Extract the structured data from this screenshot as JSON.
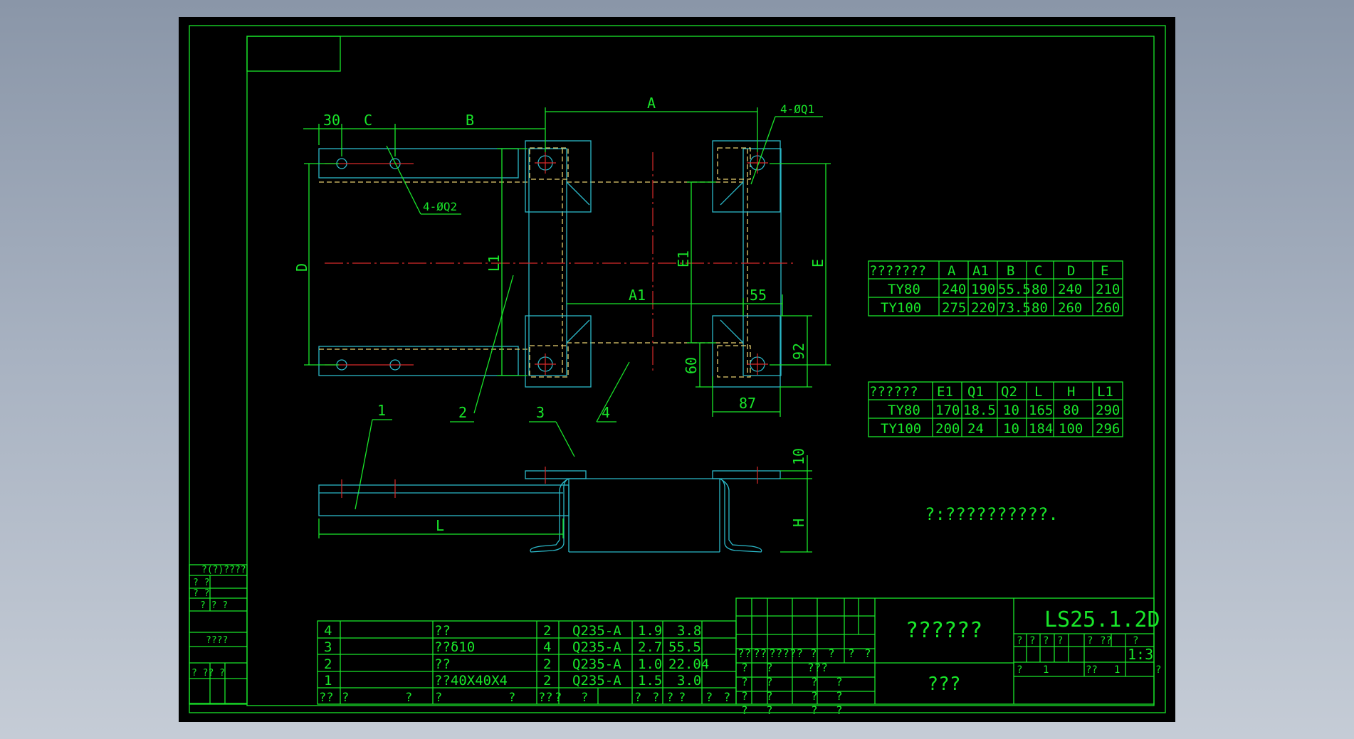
{
  "title_block": {
    "drawing_name": "??????",
    "company": "???",
    "drawing_no": "LS25.1.2D",
    "scale": "1:3",
    "row_a": [
      "?",
      "?",
      "?",
      "?",
      "?",
      "??",
      "?"
    ],
    "row_b": [
      "?",
      "1",
      "??",
      "1",
      "?"
    ]
  },
  "sign_rows": [
    [
      "??",
      "??",
      "?????",
      "?",
      "?",
      "?",
      "?"
    ],
    [
      "?",
      "?",
      "???"
    ],
    [
      "?",
      "?",
      "?",
      "?"
    ],
    [
      "?",
      "?",
      "?",
      "?"
    ],
    [
      "?",
      "?",
      "?",
      "?"
    ]
  ],
  "sidebar": {
    "rows": [
      "?(?)????",
      "? ?",
      "? ?",
      "? ? ?",
      "????",
      "? ?? ?"
    ]
  },
  "bom": {
    "rows": [
      {
        "no": "4",
        "name": "??",
        "qty": "2",
        "material": "Q235-A",
        "unit_w": "1.9",
        "total_w": "3.8"
      },
      {
        "no": "3",
        "name": "??δ10",
        "qty": "4",
        "material": "Q235-A",
        "unit_w": "2.7",
        "total_w": "55.5"
      },
      {
        "no": "2",
        "name": "??",
        "qty": "2",
        "material": "Q235-A",
        "unit_w": "1.0",
        "total_w": "22.04"
      },
      {
        "no": "1",
        "name": "??40X40X4",
        "qty": "2",
        "material": "Q235-A",
        "unit_w": "1.5",
        "total_w": "3.0"
      }
    ],
    "header": [
      "??",
      "?",
      "?",
      "?",
      "?",
      "??",
      "?",
      "?",
      "?",
      "?",
      "?",
      "?",
      "?",
      "?"
    ]
  },
  "table1": {
    "headers": [
      "???????",
      "A",
      "A1",
      "B",
      "C",
      "D",
      "E"
    ],
    "rows": [
      [
        "TY80",
        "240",
        "190",
        "55.5",
        "80",
        "240",
        "210"
      ],
      [
        "TY100",
        "275",
        "220",
        "73.5",
        "80",
        "260",
        "260"
      ]
    ]
  },
  "table2": {
    "headers": [
      "??????",
      "E1",
      "Q1",
      "Q2",
      "L",
      "H",
      "L1"
    ],
    "rows": [
      [
        "TY80",
        "170",
        "18.5",
        "10",
        "165",
        "80",
        "290"
      ],
      [
        "TY100",
        "200",
        "24",
        "10",
        "184",
        "100",
        "296"
      ]
    ]
  },
  "note": "?:??????????.",
  "dims": {
    "a": "A",
    "a1": "A1",
    "b": "B",
    "c": "C",
    "thirty": "30",
    "d": "D",
    "e": "E",
    "e1": "E1",
    "l1": "L1",
    "fifty_five": "55",
    "ninety_two": "92",
    "sixty": "60",
    "eighty_seven": "87",
    "ten": "10",
    "h": "H",
    "l": "L",
    "q1_label": "4-ØQ1",
    "q2_label": "4-ØQ2"
  },
  "balloons": [
    "1",
    "2",
    "3",
    "4"
  ],
  "colors": {
    "line": "#19e62a",
    "part": "#2bb8c8",
    "hidden": "#e8d070",
    "center": "#d82a2a",
    "background": "#000000"
  }
}
